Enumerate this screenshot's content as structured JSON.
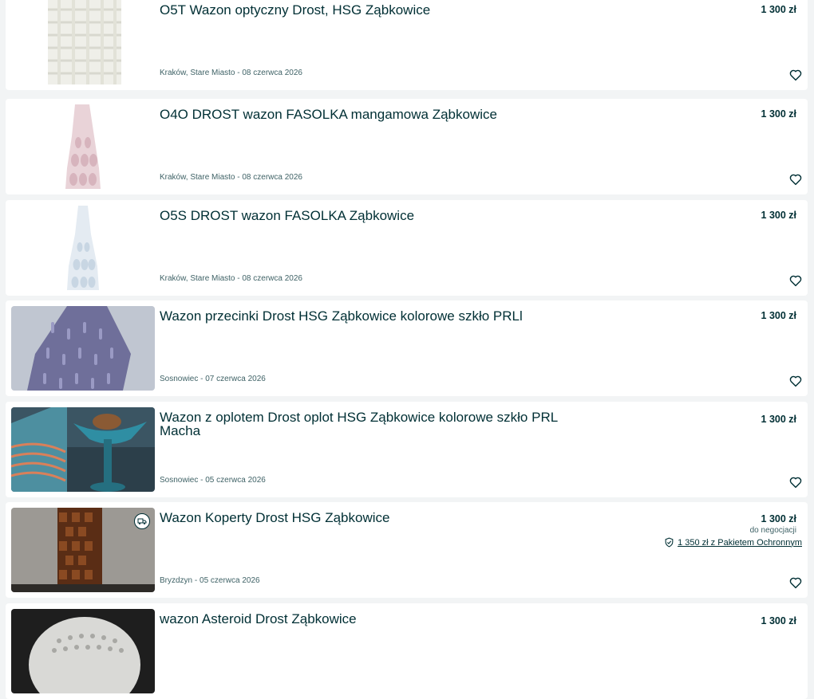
{
  "listings": [
    {
      "title": "O5T Wazon optyczny Drost, HSG Ząbkowice",
      "location_date": "Kraków, Stare Miasto - 08 czerwca 2026",
      "price": "1 300 zł"
    },
    {
      "title": "O4O DROST wazon FASOLKA mangamowa Ząbkowice",
      "location_date": "Kraków, Stare Miasto - 08 czerwca 2026",
      "price": "1 300 zł"
    },
    {
      "title": "O5S DROST wazon FASOLKA Ząbkowice",
      "location_date": "Kraków, Stare Miasto - 08 czerwca 2026",
      "price": "1 300 zł"
    },
    {
      "title": "Wazon przecinki Drost HSG Ząbkowice kolorowe szkło PRLl",
      "location_date": "Sosnowiec - 07 czerwca 2026",
      "price": "1 300 zł"
    },
    {
      "title": "Wazon z oplotem Drost oplot HSG Ząbkowice kolorowe szkło PRL Macha",
      "location_date": "Sosnowiec - 05 czerwca 2026",
      "price": "1 300 zł"
    },
    {
      "title": "Wazon Koperty Drost HSG Ząbkowice",
      "location_date": "Bryzdzyn - 05 czerwca 2026",
      "price": "1 300 zł",
      "negotiable": "do negocjacji",
      "protection": "1 350 zł z Pakietem Ochronnym",
      "shipping_icon": "truck-icon"
    },
    {
      "title": "wazon Asteroid Drost Ząbkowice",
      "location_date": "",
      "price": "1 300 zł"
    }
  ],
  "icons": {
    "favorite": "heart-icon",
    "protection": "shield-check-icon",
    "shipping": "truck-icon"
  },
  "colors": {
    "text": "#002f34",
    "muted": "#406367",
    "background": "#f2f4f5",
    "card": "#ffffff"
  }
}
